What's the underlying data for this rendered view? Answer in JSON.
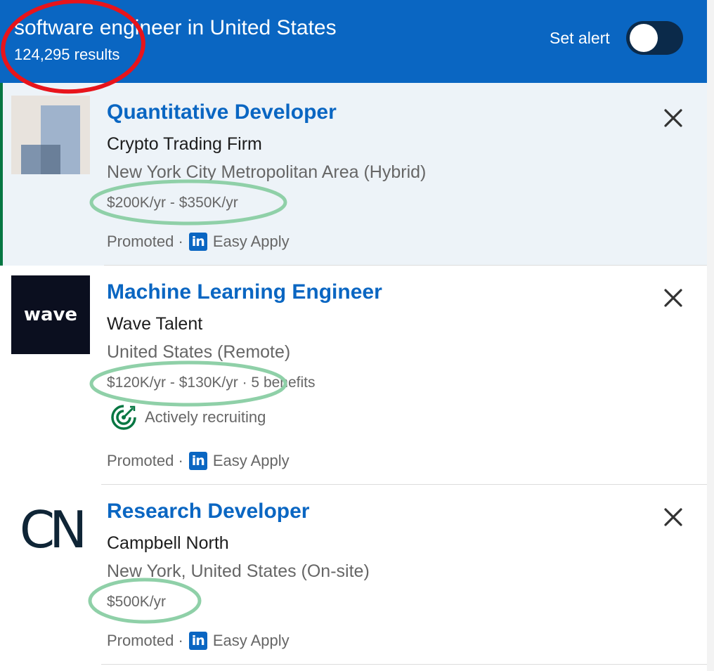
{
  "header": {
    "title": "software engineer in United States",
    "result_count": "124,295 results",
    "alert_label": "Set alert"
  },
  "jobs": [
    {
      "title": "Quantitative Developer",
      "company": "Crypto Trading Firm",
      "location": "New York City Metropolitan Area (Hybrid)",
      "salary": "$200K/yr - $350K/yr",
      "promoted": "Promoted ·",
      "apply": "Easy Apply"
    },
    {
      "title": "Machine Learning Engineer",
      "company": "Wave Talent",
      "logo_text": "wave",
      "location": "United States (Remote)",
      "salary": "$120K/yr - $130K/yr · 5 benefits",
      "badge": "Actively recruiting",
      "promoted": "Promoted ·",
      "apply": "Easy Apply"
    },
    {
      "title": "Research Developer",
      "company": "Campbell North",
      "logo_text": "CN",
      "location": "New York, United States (On-site)",
      "salary": "$500K/yr",
      "promoted": "Promoted ·",
      "apply": "Easy Apply"
    }
  ],
  "icons": {
    "linkedin": "in",
    "dismiss": "close-icon",
    "recruiting": "target-icon"
  },
  "colors": {
    "brand": "#0a66c2",
    "annotation_red": "#e8141b",
    "annotation_green": "#8fd0a8",
    "selected_accent": "#057642"
  }
}
